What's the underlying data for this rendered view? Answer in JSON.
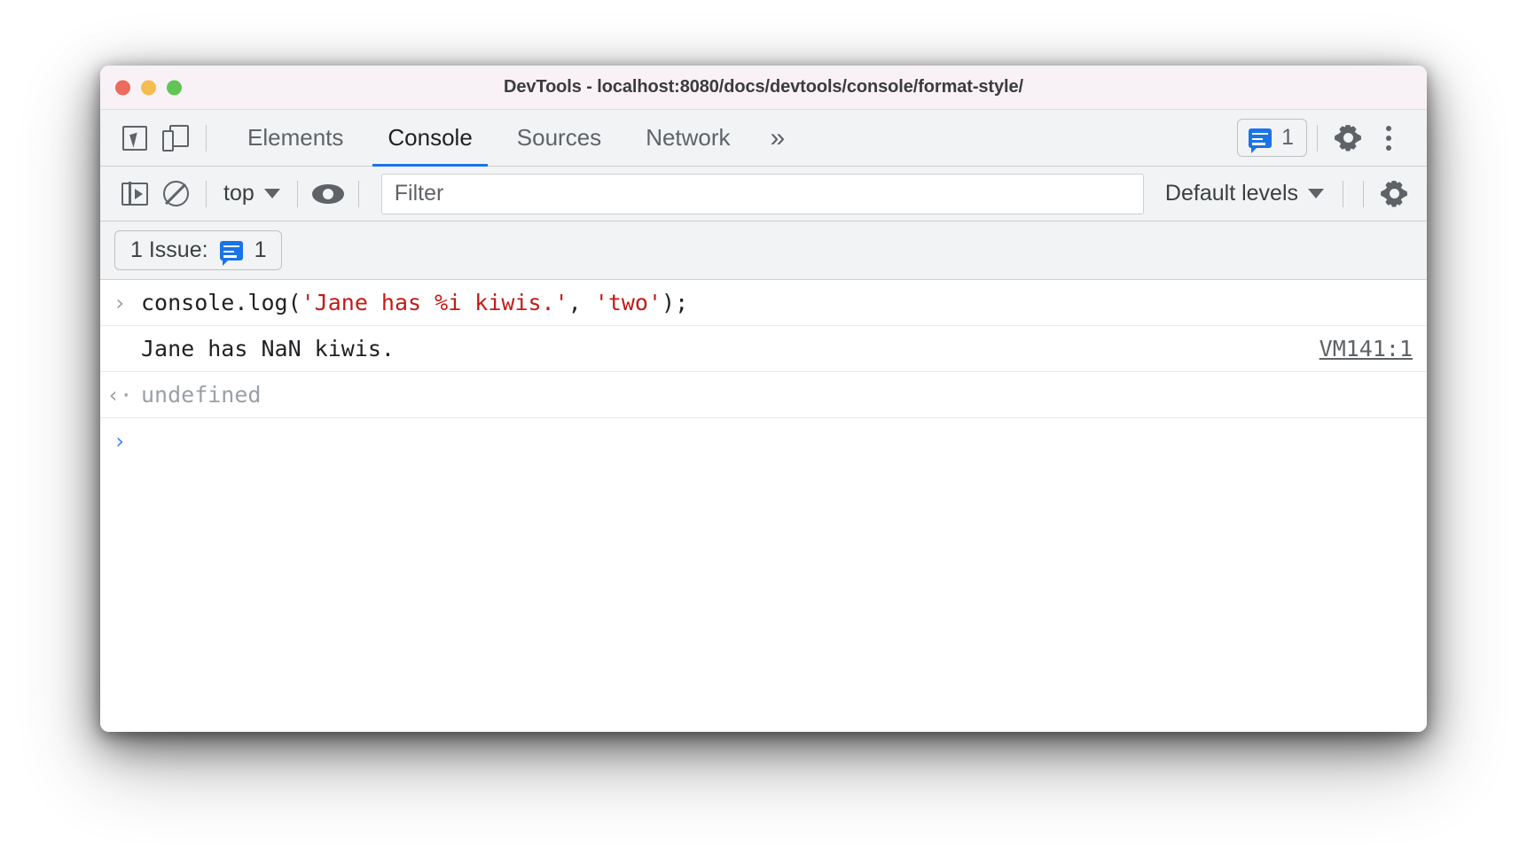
{
  "window": {
    "title": "DevTools - localhost:8080/docs/devtools/console/format-style/",
    "traffic_lights": [
      "close",
      "minimize",
      "zoom"
    ],
    "colors": {
      "close": "#ec6a5e",
      "minimize": "#f4bd4f",
      "zoom": "#61c554",
      "accent_blue": "#1a73e8",
      "string_red": "#c41a16",
      "muted_gray": "#9aa0a6"
    }
  },
  "tabbar": {
    "inspect_icon": "inspect-cursor-icon",
    "device_icon": "device-toolbar-icon",
    "tabs": [
      {
        "label": "Elements",
        "active": false
      },
      {
        "label": "Console",
        "active": true
      },
      {
        "label": "Sources",
        "active": false
      },
      {
        "label": "Network",
        "active": false
      }
    ],
    "more_tabs_label": "»",
    "issues_badge": {
      "icon": "issues-bubble-icon",
      "count": "1"
    },
    "settings_icon": "gear-icon",
    "more_options_icon": "kebab-menu-icon"
  },
  "console_toolbar": {
    "sidebar_toggle_icon": "console-sidebar-icon",
    "clear_console_icon": "clear-console-icon",
    "context_selector": "top",
    "context_caret": "▼",
    "live_expression_icon": "eye-icon",
    "filter": {
      "placeholder": "Filter",
      "value": ""
    },
    "levels_selector": "Default levels",
    "levels_caret": "▼",
    "settings_icon": "console-settings-gear-icon"
  },
  "issues_bar": {
    "label": "1 Issue:",
    "badge_icon": "issues-bubble-icon",
    "count": "1"
  },
  "console": {
    "entries": [
      {
        "type": "input",
        "gutter": "›",
        "code_prefix": "console.log(",
        "code_string1": "'Jane has %i kiwis.'",
        "code_comma": ", ",
        "code_string2": "'two'",
        "code_suffix": ");",
        "source": ""
      },
      {
        "type": "output",
        "gutter": "",
        "text": "Jane has NaN kiwis.",
        "source": "VM141:1"
      },
      {
        "type": "result",
        "gutter": "‹·",
        "text": "undefined",
        "source": ""
      },
      {
        "type": "prompt",
        "gutter": "›",
        "text": "",
        "source": ""
      }
    ]
  }
}
